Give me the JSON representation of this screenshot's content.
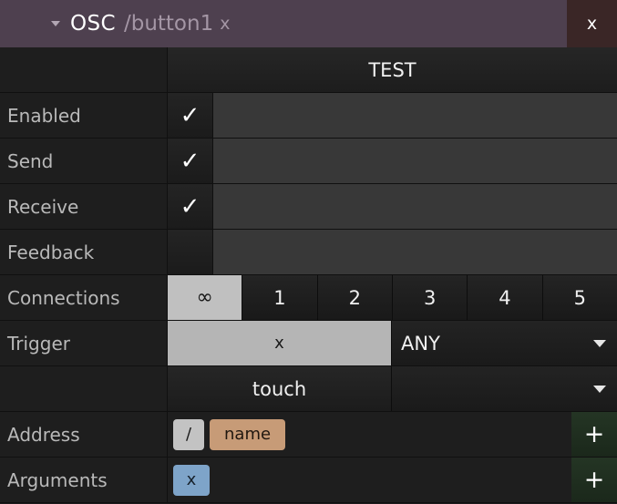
{
  "titlebar": {
    "toggle_icon": "triangle-down-icon",
    "protocol": "OSC",
    "path": "/button1",
    "argument": "x",
    "close_label": "x",
    "bg_color": "#4e404f",
    "close_bg_color": "#3a2626"
  },
  "header": {
    "corner_label": "",
    "column_label": "TEST"
  },
  "rows": {
    "enabled": {
      "label": "Enabled",
      "checked": true,
      "check_glyph": "✓"
    },
    "send": {
      "label": "Send",
      "checked": true,
      "check_glyph": "✓"
    },
    "receive": {
      "label": "Receive",
      "checked": true,
      "check_glyph": "✓"
    },
    "feedback": {
      "label": "Feedback",
      "checked": false,
      "check_glyph": ""
    }
  },
  "connections": {
    "label": "Connections",
    "options": [
      {
        "label": "∞",
        "selected": true
      },
      {
        "label": "1",
        "selected": false
      },
      {
        "label": "2",
        "selected": false
      },
      {
        "label": "3",
        "selected": false
      },
      {
        "label": "4",
        "selected": false
      },
      {
        "label": "5",
        "selected": false
      }
    ],
    "selected_value": "∞"
  },
  "trigger": {
    "label": "Trigger",
    "primary_button": "x",
    "primary_selected": true,
    "primary_dropdown_value": "ANY",
    "secondary_button": "touch",
    "secondary_dropdown_value": "",
    "caret_icon": "chevron-down-icon"
  },
  "address": {
    "label": "Address",
    "chips": [
      {
        "text": "/",
        "type": "slash",
        "color": "#c3c3c3"
      },
      {
        "text": "name",
        "type": "name",
        "color": "#c79b77"
      }
    ],
    "add_label": "+",
    "add_icon": "plus-icon"
  },
  "arguments": {
    "label": "Arguments",
    "chips": [
      {
        "text": "x",
        "type": "arg",
        "color": "#7ea4c9"
      }
    ],
    "add_label": "+",
    "add_icon": "plus-icon"
  }
}
